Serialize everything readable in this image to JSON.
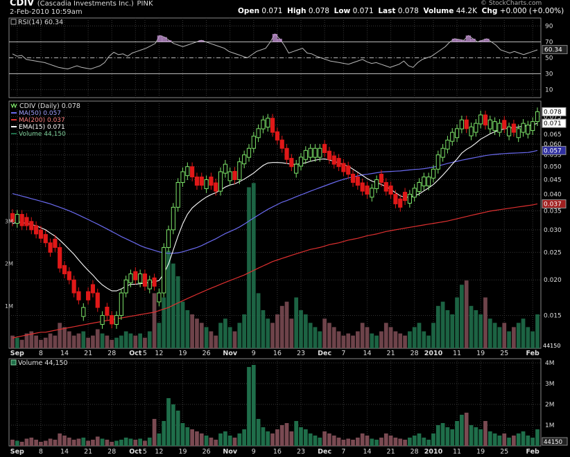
{
  "header": {
    "symbol": "CDIV",
    "company": "(Cascadia Investments Inc.)",
    "exchange": "PINK",
    "datetime": "2-Feb-2010 10:59am",
    "open_label": "Open",
    "open": "0.071",
    "high_label": "High",
    "high": "0.078",
    "low_label": "Low",
    "low": "0.071",
    "last_label": "Last",
    "last": "0.078",
    "volume_label": "Volume",
    "volume": "44.2K",
    "chg_label": "Chg",
    "chg": "+0.000 (+0.00%)",
    "watermark": "© StockCharts.com"
  },
  "rsi_legend": "RSI(14) 60.34",
  "price_legend": {
    "title": "CDIV (Daily) 0.078",
    "ma50": "MA(50) 0.057",
    "ma200": "MA(200) 0.037",
    "ema15": "EMA(15) 0.071",
    "volume": "Volume 44,150"
  },
  "volume_legend": "Volume 44,150",
  "colors": {
    "background": "#000000",
    "grid": "#3a3a3a",
    "up_candle": "#7ee66a",
    "down_candle": "#e01818",
    "ma50": "#6a6af0",
    "ma200": "#e03030",
    "ema15": "#ffffff",
    "rsi_line": "#bbbbbb",
    "volume_up": "#1f6e4a",
    "volume_down": "#7a4a52"
  },
  "chart_data": [
    {
      "type": "line",
      "name": "RSI(14)",
      "ylim": [
        0,
        100
      ],
      "yticks": [
        10,
        30,
        50,
        70,
        90
      ],
      "levels": [
        30,
        50,
        70
      ],
      "last_value": 60.34,
      "last_label": "60.34",
      "values": [
        55,
        52,
        53,
        48,
        47,
        46,
        45,
        44,
        42,
        40,
        38,
        37,
        36,
        38,
        40,
        38,
        37,
        36,
        38,
        40,
        44,
        52,
        57,
        54,
        55,
        52,
        56,
        58,
        60,
        62,
        65,
        68,
        78,
        76,
        72,
        68,
        66,
        64,
        66,
        68,
        70,
        72,
        70,
        68,
        66,
        64,
        62,
        58,
        56,
        54,
        52,
        50,
        54,
        58,
        60,
        62,
        70,
        80,
        74,
        66,
        56,
        58,
        60,
        62,
        56,
        55,
        52,
        50,
        48,
        46,
        45,
        44,
        43,
        42,
        44,
        46,
        48,
        45,
        43,
        44,
        42,
        40,
        38,
        40,
        42,
        46,
        40,
        38,
        44,
        48,
        50,
        52,
        56,
        60,
        64,
        70,
        74,
        73,
        72,
        78,
        74,
        70,
        72,
        74,
        70,
        66,
        60,
        58,
        56,
        58,
        56,
        54,
        56,
        58,
        60
      ]
    },
    {
      "type": "candlestick",
      "name": "CDIV (Daily)",
      "scale": "log",
      "ylim": [
        0.0115,
        0.085
      ],
      "yticks": [
        0.015,
        0.02,
        0.025,
        0.03,
        0.035,
        0.04,
        0.045,
        0.05,
        0.055,
        0.06,
        0.065,
        0.07,
        0.075
      ],
      "ytick_labels": [
        "0.015",
        "0.020",
        "0.025",
        "0.030",
        "0.035",
        "0.040",
        "0.045",
        "0.050",
        "0.055",
        "0.060",
        "0.065",
        "0.070",
        "0.075"
      ],
      "right_labels": [
        {
          "value": 0.078,
          "label": "0.078",
          "style": "price"
        },
        {
          "value": 0.071,
          "label": "0.071",
          "style": "ema"
        },
        {
          "value": 0.057,
          "label": "0.057",
          "style": "ma50"
        },
        {
          "value": 0.037,
          "label": "0.037",
          "style": "ma200"
        }
      ],
      "x_labels": [
        {
          "i": 1,
          "label": "Sep"
        },
        {
          "i": 6,
          "label": "8"
        },
        {
          "i": 11,
          "label": "14"
        },
        {
          "i": 16,
          "label": "21"
        },
        {
          "i": 21,
          "label": "28"
        },
        {
          "i": 26,
          "label": "Oct"
        },
        {
          "i": 28,
          "label": "5"
        },
        {
          "i": 31,
          "label": "12"
        },
        {
          "i": 36,
          "label": "19"
        },
        {
          "i": 41,
          "label": "26"
        },
        {
          "i": 46,
          "label": "Nov"
        },
        {
          "i": 51,
          "label": "9"
        },
        {
          "i": 56,
          "label": "16"
        },
        {
          "i": 61,
          "label": "23"
        },
        {
          "i": 66,
          "label": "Dec"
        },
        {
          "i": 70,
          "label": "7"
        },
        {
          "i": 75,
          "label": "14"
        },
        {
          "i": 80,
          "label": "21"
        },
        {
          "i": 85,
          "label": "28"
        },
        {
          "i": 89,
          "label": "2010"
        },
        {
          "i": 94,
          "label": "11"
        },
        {
          "i": 99,
          "label": "19"
        },
        {
          "i": 104,
          "label": "25"
        },
        {
          "i": 110,
          "label": "Feb"
        }
      ],
      "close": [
        0.032,
        0.034,
        0.031,
        0.031,
        0.03,
        0.029,
        0.028,
        0.027,
        0.025,
        0.026,
        0.022,
        0.021,
        0.02,
        0.018,
        0.017,
        0.016,
        0.017,
        0.018,
        0.016,
        0.015,
        0.015,
        0.014,
        0.015,
        0.018,
        0.02,
        0.021,
        0.02,
        0.021,
        0.019,
        0.02,
        0.019,
        0.018,
        0.026,
        0.03,
        0.036,
        0.044,
        0.048,
        0.05,
        0.046,
        0.043,
        0.043,
        0.045,
        0.043,
        0.041,
        0.048,
        0.051,
        0.048,
        0.045,
        0.052,
        0.055,
        0.058,
        0.064,
        0.068,
        0.073,
        0.074,
        0.066,
        0.062,
        0.058,
        0.053,
        0.05,
        0.051,
        0.054,
        0.057,
        0.058,
        0.058,
        0.058,
        0.056,
        0.053,
        0.051,
        0.05,
        0.048,
        0.047,
        0.044,
        0.043,
        0.041,
        0.04,
        0.042,
        0.045,
        0.044,
        0.041,
        0.04,
        0.037,
        0.036,
        0.038,
        0.04,
        0.042,
        0.044,
        0.046,
        0.046,
        0.049,
        0.055,
        0.058,
        0.062,
        0.066,
        0.068,
        0.073,
        0.068,
        0.069,
        0.071,
        0.076,
        0.07,
        0.073,
        0.072,
        0.071,
        0.068,
        0.069,
        0.066,
        0.068,
        0.071,
        0.07,
        0.072,
        0.078
      ],
      "ma50": [
        0.0402,
        0.0398,
        0.0394,
        0.039,
        0.0386,
        0.0382,
        0.0378,
        0.0374,
        0.037,
        0.0365,
        0.036,
        0.0355,
        0.035,
        0.0344,
        0.0338,
        0.0332,
        0.0326,
        0.032,
        0.0314,
        0.0308,
        0.0302,
        0.0296,
        0.029,
        0.0284,
        0.0279,
        0.0274,
        0.0269,
        0.0264,
        0.026,
        0.0257,
        0.0254,
        0.0251,
        0.0249,
        0.0248,
        0.0248,
        0.0249,
        0.0251,
        0.0254,
        0.0257,
        0.026,
        0.0264,
        0.0269,
        0.0274,
        0.0279,
        0.0285,
        0.0291,
        0.0296,
        0.0301,
        0.0307,
        0.0314,
        0.0322,
        0.033,
        0.0338,
        0.0346,
        0.0354,
        0.0361,
        0.0368,
        0.0375,
        0.038,
        0.0386,
        0.0392,
        0.0398,
        0.0404,
        0.041,
        0.0416,
        0.0422,
        0.0428,
        0.0434,
        0.044,
        0.0446,
        0.0451,
        0.0456,
        0.046,
        0.0464,
        0.0468,
        0.047,
        0.0473,
        0.0476,
        0.0479,
        0.048,
        0.0481,
        0.0482,
        0.0483,
        0.0485,
        0.0487,
        0.0489,
        0.049,
        0.0492,
        0.0495,
        0.0498,
        0.0503,
        0.0508,
        0.0513,
        0.0518,
        0.0522,
        0.0527,
        0.0531,
        0.0535,
        0.0539,
        0.0543,
        0.0547,
        0.055,
        0.0552,
        0.0554,
        0.0556,
        0.0557,
        0.0558,
        0.0559,
        0.056,
        0.0561,
        0.0565,
        0.057
      ],
      "ma200": [
        0.0125,
        0.0126,
        0.0127,
        0.0128,
        0.0129,
        0.013,
        0.0131,
        0.0131,
        0.0132,
        0.0133,
        0.0134,
        0.0135,
        0.0136,
        0.0137,
        0.0138,
        0.0139,
        0.014,
        0.0141,
        0.0142,
        0.0143,
        0.0144,
        0.0145,
        0.0146,
        0.0147,
        0.0148,
        0.0149,
        0.015,
        0.0151,
        0.0152,
        0.0153,
        0.0154,
        0.0156,
        0.0158,
        0.016,
        0.0163,
        0.0166,
        0.0169,
        0.0172,
        0.0175,
        0.0178,
        0.0181,
        0.0184,
        0.0187,
        0.019,
        0.0193,
        0.0196,
        0.0199,
        0.0202,
        0.0205,
        0.0208,
        0.0212,
        0.0216,
        0.022,
        0.0224,
        0.0228,
        0.0232,
        0.0235,
        0.0238,
        0.0241,
        0.0244,
        0.0247,
        0.025,
        0.0253,
        0.0256,
        0.0258,
        0.026,
        0.0263,
        0.0266,
        0.0268,
        0.027,
        0.0273,
        0.0276,
        0.0278,
        0.028,
        0.0283,
        0.0286,
        0.0288,
        0.029,
        0.0293,
        0.0296,
        0.0298,
        0.03,
        0.0302,
        0.0304,
        0.0306,
        0.0308,
        0.031,
        0.0312,
        0.0314,
        0.0316,
        0.0318,
        0.032,
        0.0322,
        0.0325,
        0.0328,
        0.0331,
        0.0334,
        0.0337,
        0.034,
        0.0343,
        0.0346,
        0.0349,
        0.0351,
        0.0353,
        0.0355,
        0.0357,
        0.0359,
        0.0361,
        0.0363,
        0.0365,
        0.0367,
        0.037
      ],
      "ema15": [
        0.0315,
        0.032,
        0.0318,
        0.0316,
        0.0313,
        0.031,
        0.0305,
        0.03,
        0.0292,
        0.0285,
        0.0276,
        0.0266,
        0.0256,
        0.0246,
        0.0235,
        0.0225,
        0.0216,
        0.0208,
        0.0199,
        0.0192,
        0.0187,
        0.0183,
        0.0183,
        0.0186,
        0.019,
        0.0193,
        0.0193,
        0.0194,
        0.0195,
        0.0196,
        0.0197,
        0.0199,
        0.021,
        0.0228,
        0.0255,
        0.0285,
        0.0315,
        0.034,
        0.0358,
        0.037,
        0.0381,
        0.0391,
        0.0399,
        0.0405,
        0.0414,
        0.0424,
        0.0431,
        0.0435,
        0.0443,
        0.0452,
        0.0463,
        0.0475,
        0.049,
        0.0505,
        0.0515,
        0.0517,
        0.0517,
        0.0516,
        0.0513,
        0.051,
        0.051,
        0.0512,
        0.0516,
        0.0522,
        0.0527,
        0.0531,
        0.0532,
        0.0528,
        0.0522,
        0.0515,
        0.0508,
        0.0502,
        0.049,
        0.0478,
        0.0466,
        0.0454,
        0.0445,
        0.0439,
        0.0433,
        0.0425,
        0.0416,
        0.0405,
        0.0395,
        0.039,
        0.0391,
        0.0395,
        0.0401,
        0.0411,
        0.0421,
        0.0433,
        0.0449,
        0.0467,
        0.0487,
        0.051,
        0.0532,
        0.0558,
        0.0575,
        0.0588,
        0.0605,
        0.0625,
        0.0638,
        0.0652,
        0.0663,
        0.0672,
        0.0678,
        0.0683,
        0.0686,
        0.0689,
        0.0694,
        0.0697,
        0.0702,
        0.071
      ],
      "up_candles": [
        1,
        15,
        19,
        22,
        23,
        24,
        25,
        27,
        29,
        31,
        32,
        33,
        34,
        35,
        36,
        37,
        41,
        44,
        45,
        46,
        48,
        49,
        50,
        51,
        52,
        53,
        54,
        60,
        61,
        62,
        63,
        64,
        65,
        76,
        77,
        84,
        85,
        86,
        87,
        88,
        89,
        90,
        91,
        92,
        93,
        94,
        95,
        97,
        98,
        99,
        101,
        102,
        103,
        105,
        107,
        108,
        109,
        110,
        111
      ],
      "volume_scale": 4200000,
      "yticks_volume": [
        1000000,
        2000000,
        3000000,
        4000000
      ],
      "ytick_labels_volume": [
        "1M",
        "2M",
        "3M",
        "4M"
      ],
      "volume_last_label": "44150",
      "volume": [
        300000,
        250000,
        200000,
        350000,
        400000,
        300000,
        200000,
        250000,
        350000,
        300000,
        600000,
        500000,
        400000,
        300000,
        350000,
        400000,
        250000,
        300000,
        450000,
        350000,
        300000,
        200000,
        250000,
        300000,
        400000,
        350000,
        300000,
        350000,
        250000,
        400000,
        1300000,
        600000,
        1200000,
        2300000,
        2000000,
        1700000,
        1100000,
        900000,
        800000,
        700000,
        600000,
        500000,
        400000,
        300000,
        600000,
        700000,
        500000,
        400000,
        600000,
        800000,
        3800000,
        3900000,
        1300000,
        900000,
        700000,
        600000,
        800000,
        1000000,
        1100000,
        700000,
        1200000,
        900000,
        800000,
        600000,
        500000,
        400000,
        700000,
        600000,
        500000,
        400000,
        300000,
        350000,
        300000,
        400000,
        600000,
        500000,
        350000,
        300000,
        400000,
        600000,
        500000,
        400000,
        350000,
        300000,
        400000,
        500000,
        600000,
        400000,
        300000,
        600000,
        1000000,
        1100000,
        900000,
        800000,
        1200000,
        1500000,
        1600000,
        1000000,
        900000,
        800000,
        1200000,
        700000,
        600000,
        500000,
        600000,
        400000,
        500000,
        600000,
        700000,
        500000,
        400000,
        800000
      ]
    }
  ]
}
